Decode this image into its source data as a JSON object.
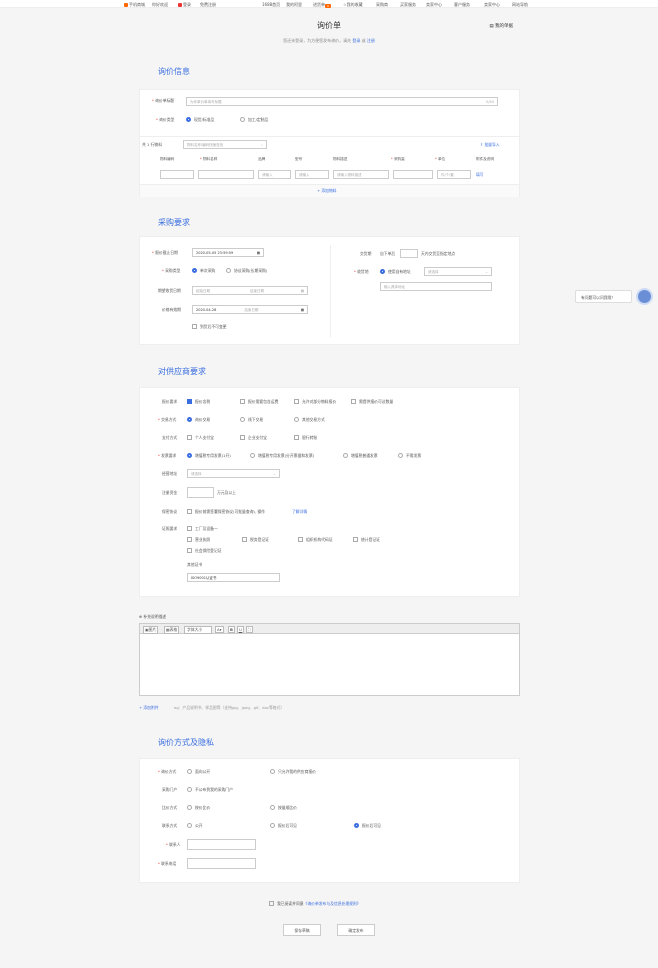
{
  "topbar": {
    "left1": "手机商城",
    "left2": "你好欢迎",
    "left3": "免费注册",
    "items": [
      "1688首页",
      "我的阿里",
      "进货单",
      "我的收藏",
      "采购商",
      "买家服务",
      "卖家中心",
      "客户服务",
      "网站导航"
    ],
    "cart_count": "0"
  },
  "page": {
    "title": "询价单",
    "subtitle": "您还未登录，为方便您发布询价，请先",
    "login": "登录",
    "or": "或",
    "register": "注册",
    "my_rfq": "我的单据"
  },
  "sec1": {
    "title": "询价信息",
    "rfq_title_label": "询价单标题",
    "rfq_title_ph": "为你单价单填写标题",
    "rfq_title_count": "0/40",
    "type_label": "询价类型",
    "type_opt1": "现货/标准品",
    "type_opt2": "加工/定制品",
    "material_count": "共 1 行物料",
    "material_search_ph": "物料名称/编码快速查找",
    "batch_import": "批量导入",
    "columns": [
      "物料编码",
      "物料名称",
      "品牌",
      "型号",
      "物料描述",
      "采购量",
      "单位",
      "附件及说明"
    ],
    "ph_brand": "请输入",
    "ph_model": "请输入",
    "ph_desc": "请输入物料描述",
    "ph_unit": "件/个/套",
    "fill": "填写",
    "add_material": "+ 添加物料"
  },
  "sec2": {
    "title": "采购要求",
    "deadline_label": "报价截止日期",
    "deadline_value": "2020-05-05 23:59:59",
    "purchase_type_label": "采购类型",
    "pt_opt1": "单次采购",
    "pt_opt2": "协议采购(长期采购)",
    "expect_label": "期望收货日期",
    "start_ph": "起始日期",
    "end_ph": "结束日期",
    "valid_label": "价格有效期",
    "valid_value": "2020-04-28",
    "valid_end_ph": "结束日期",
    "no_change": "到货后不可变更",
    "delivery_label": "交货期",
    "delivery_pre": "自下单后",
    "delivery_post": "天内交货至指定地点",
    "address_label": "收货地",
    "address_opt": "使用自有地址",
    "address_select": "请选择",
    "address_detail_ph": "输入具体地址"
  },
  "sec3": {
    "title": "对供应商要求",
    "quote_req_label": "报价要求",
    "qr_opt1": "报价含税",
    "qr_opt2": "报价需要包含运费",
    "qr_opt3": "允许对部分物料报价",
    "qr_opt4": "需提供报价可议数量",
    "trade_label": "交易方式",
    "trade_opt1": "询价交易",
    "trade_opt2": "线下交易",
    "trade_opt3": "其他交易方式",
    "pay_label": "支付方式",
    "pay_opt1": "个人支付宝",
    "pay_opt2": "企业支付宝",
    "pay_opt3": "银行转账",
    "invoice_label": "发票要求",
    "inv_opt1": "增值税专用发票(1开)",
    "inv_opt2": "增值税专用发票(分开票据和发票)",
    "inv_opt3": "增值税普通发票",
    "inv_opt4": "不需发票",
    "reg_addr_label": "经营地址",
    "reg_addr_ph": "请选择",
    "capital_label": "注册资金",
    "capital_unit": "万元及以上",
    "protocol_label": "保密协议",
    "protocol_text": "报价前需签署保密协议(可批量查询), 操作",
    "protocol_link": "了解详情",
    "cert_label": "证照要求",
    "cert1": "工厂及设备一",
    "cert2": "营业执照",
    "cert3": "税务登记证",
    "cert4": "组织机构代码证",
    "cert5": "统计登记证",
    "cert6": "社会保险登记证",
    "other_label": "其他证书",
    "other_value": "ISO9001认证书"
  },
  "editor": {
    "label": "补充说明描述",
    "tb_pic": "图片",
    "tb_table": "表格",
    "tb_size": "字体大小",
    "tb_a": "A",
    "tb_b": "B",
    "tb_u": "U",
    "attach": "+ 添加附件",
    "attach_hint": "eg：产品说明书、样品图等（支持jpg、jpeg、gif、doc等格式）"
  },
  "sec4": {
    "title": "询价方式及隐私",
    "rfq_mode_label": "询价方式",
    "m_opt1": "面向公开",
    "m_opt2": "只允许我的供应商报价",
    "portal_label": "采购门户",
    "portal_opt": "不公布到我的采购门户",
    "compare_label": "比价方式",
    "c_opt1": "按价比价",
    "c_opt2": "按量顺比价",
    "contact_label": "联系方式",
    "ct_opt1": "公开",
    "ct_opt2": "报价后可见",
    "ct_opt3": "报价后可见",
    "person_label": "联系人",
    "phone_label": "联系电话"
  },
  "footer": {
    "agree_pre": "我已阅读并同意",
    "agree_link": "《询价单发布与及信息处理规则》",
    "save": "保存草稿",
    "publish": "确定发布"
  },
  "chat": {
    "bubble": "有问题可以问我哦！"
  },
  "colors": {
    "accent": "#3a6ee0",
    "required": "#e44444"
  }
}
